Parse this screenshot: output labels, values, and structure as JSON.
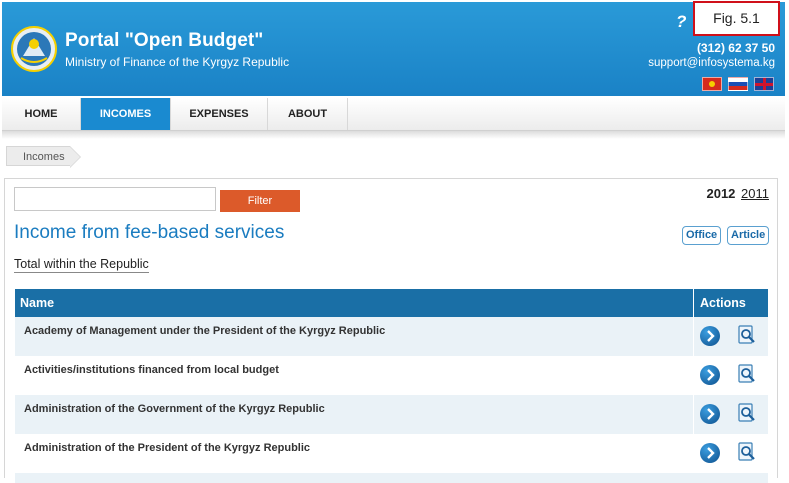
{
  "header": {
    "title": "Portal \"Open Budget\"",
    "subtitle": "Ministry of Finance of the Kyrgyz Republic",
    "help": "?",
    "figure_label": "Fig. 5.1",
    "phone": "(312) 62 37 50",
    "email": "support@infosystema.kg",
    "languages": [
      "Kyrgyz",
      "Russian",
      "English"
    ]
  },
  "nav": {
    "items": [
      {
        "label": "HOME"
      },
      {
        "label": "INCOMES"
      },
      {
        "label": "EXPENSES"
      },
      {
        "label": "ABOUT"
      }
    ],
    "active": "INCOMES"
  },
  "breadcrumb": {
    "label": "Incomes"
  },
  "search": {
    "value": "",
    "placeholder": ""
  },
  "filter_label": "Filter",
  "years": {
    "current": "2012",
    "other": "2011"
  },
  "section": {
    "title": "Income from fee-based services"
  },
  "buttons": {
    "office": "Office",
    "article": "Article"
  },
  "scope": "Total within the Republic",
  "table": {
    "headers": {
      "name": "Name",
      "actions": "Actions"
    },
    "rows": [
      {
        "name": "Academy of Management under the President of the Kyrgyz Republic"
      },
      {
        "name": "Activities/institutions financed from local budget"
      },
      {
        "name": "Administration of the Government of the Kyrgyz Republic"
      },
      {
        "name": "Administration of the President of the Kyrgyz Republic"
      }
    ]
  },
  "colors": {
    "header_blue": "#1a82c6",
    "nav_active": "#1a8ad0",
    "table_header": "#1a6fa6",
    "filter_orange": "#dc5a2a",
    "title_blue": "#1a7cc0"
  }
}
